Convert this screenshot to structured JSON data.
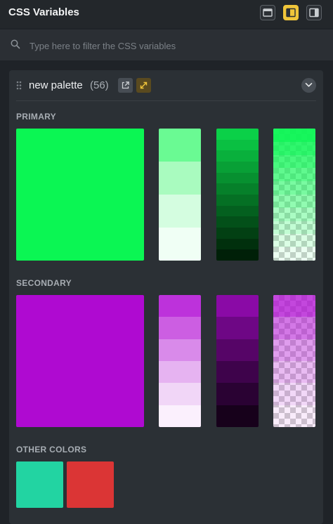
{
  "header": {
    "title": "CSS Variables",
    "layout_buttons": [
      {
        "name": "layout-floating",
        "active": false
      },
      {
        "name": "layout-dock-left",
        "active": true
      },
      {
        "name": "layout-dock-right",
        "active": false
      }
    ]
  },
  "search": {
    "placeholder": "Type here to filter the CSS variables",
    "value": ""
  },
  "palette": {
    "name": "new palette",
    "count": "(56)",
    "icons": [
      "external-link-icon",
      "expand-icon",
      "chevron-down-icon"
    ],
    "sections": {
      "primary": {
        "label": "PRIMARY",
        "base": "#0bf653",
        "tints": [
          "#6afa93",
          "#a9fbbf",
          "#d4fde0",
          "#f0fff5"
        ],
        "shades": [
          "#0bd048",
          "#0ac042",
          "#09b03c",
          "#08a036",
          "#079030",
          "#06802a",
          "#057024",
          "#04601f",
          "#035019",
          "#024013",
          "#01300d",
          "#002008"
        ],
        "alphas": [
          0.95,
          0.85,
          0.75,
          0.65,
          0.55,
          0.45,
          0.35,
          0.25,
          0.15,
          0.08
        ]
      },
      "secondary": {
        "label": "SECONDARY",
        "base": "#af0ad1",
        "tints": [
          "#bd32db",
          "#cc5ee2",
          "#d98aea",
          "#e6b3f1",
          "#f1d6f7",
          "#fbf0fd"
        ],
        "shades": [
          "#8a0aa6",
          "#6e0785",
          "#560567",
          "#3e034b",
          "#2a0233",
          "#17011b"
        ],
        "alphas": [
          0.75,
          0.55,
          0.4,
          0.28,
          0.16,
          0.08
        ]
      },
      "other": {
        "label": "OTHER COLORS",
        "colors": [
          "#22d4a2",
          "#db3535"
        ]
      }
    }
  }
}
